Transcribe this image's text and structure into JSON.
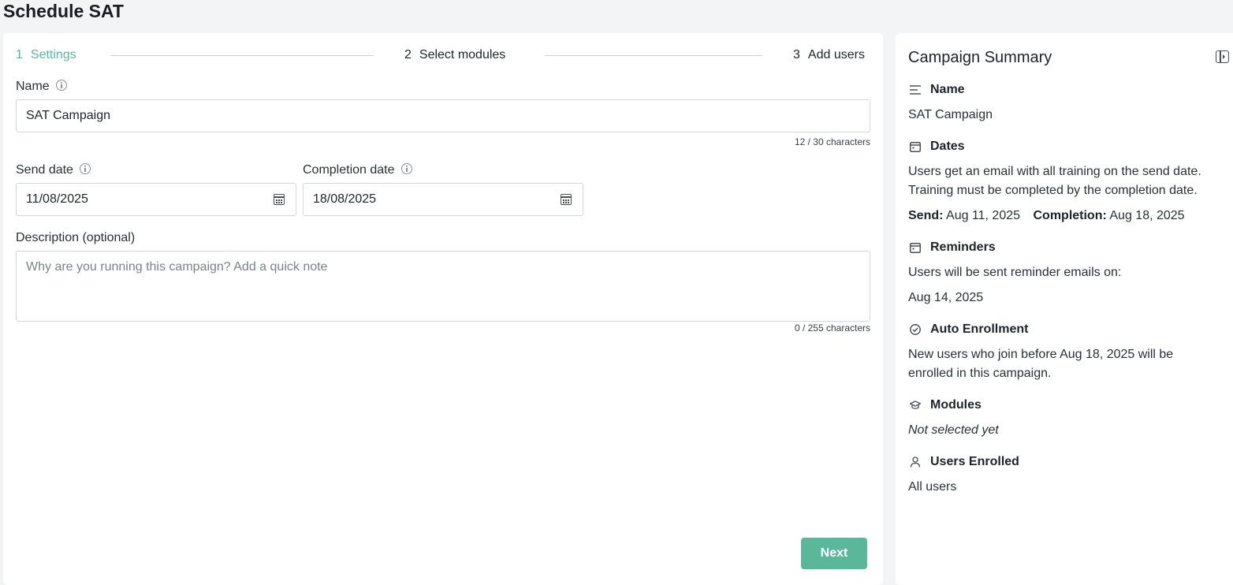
{
  "page": {
    "title": "Schedule SAT"
  },
  "stepper": {
    "steps": [
      {
        "num": "1",
        "label": "Settings"
      },
      {
        "num": "2",
        "label": "Select modules"
      },
      {
        "num": "3",
        "label": "Add users"
      }
    ]
  },
  "form": {
    "name_label": "Name",
    "name_value": "SAT Campaign",
    "name_counter": "12 / 30 characters",
    "send_label": "Send date",
    "send_value": "11/08/2025",
    "completion_label": "Completion date",
    "completion_value": "18/08/2025",
    "description_label": "Description (optional)",
    "description_placeholder": "Why are you running this campaign? Add a quick note",
    "description_counter": "0 / 255 characters",
    "next_label": "Next"
  },
  "summary": {
    "title": "Campaign Summary",
    "name_heading": "Name",
    "name_value": "SAT Campaign",
    "dates_heading": "Dates",
    "dates_line1": "Users get an email with all training on the send date.",
    "dates_line2": "Training must be completed by the completion date.",
    "send_label": "Send:",
    "send_value": "Aug 11, 2025",
    "completion_label": "Completion:",
    "completion_value": "Aug 18, 2025",
    "reminders_heading": "Reminders",
    "reminders_text": "Users will be sent reminder emails on:",
    "reminders_date": "Aug 14, 2025",
    "auto_heading": "Auto Enrollment",
    "auto_line1": "New users who join before Aug 18, 2025 will be",
    "auto_line2": "enrolled in this campaign.",
    "modules_heading": "Modules",
    "modules_value": "Not selected yet",
    "users_heading": "Users Enrolled",
    "users_value": "All users"
  },
  "colors": {
    "accent": "#5bb79a",
    "background": "#f3f4f6"
  },
  "icons": {
    "info": "info-icon",
    "calendar": "calendar-icon",
    "panel_toggle": "panel-toggle-icon",
    "lines": "text-lines-icon",
    "check_circle": "check-circle-icon",
    "graduation": "graduation-cap-icon",
    "user": "user-icon"
  }
}
